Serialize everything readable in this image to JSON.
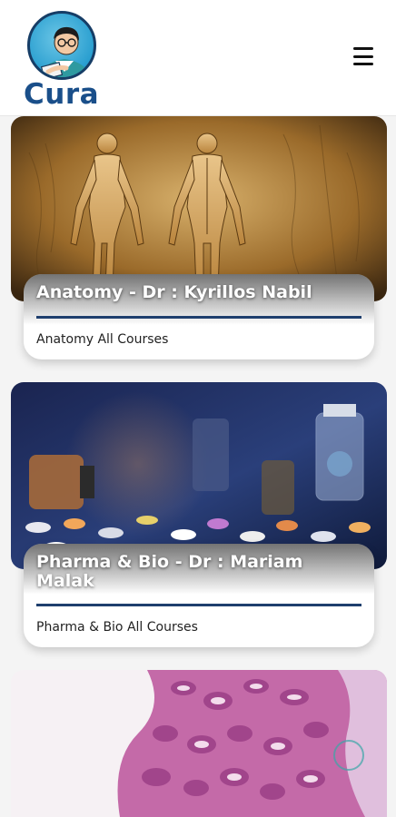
{
  "brand": {
    "name": "Cura",
    "logo_icon": "doctor-reading-book-icon"
  },
  "header": {
    "menu_icon": "hamburger-menu-icon"
  },
  "courses": [
    {
      "title": "Anatomy - Dr : Kyrillos Nabil",
      "subtitle": "Anatomy All Courses",
      "image": "anatomy-figures-image"
    },
    {
      "title": "Pharma & Bio - Dr : Mariam Malak",
      "subtitle": "Pharma & Bio All Courses",
      "image": "pills-and-bottles-image"
    },
    {
      "title": "",
      "subtitle": "",
      "image": "histology-slide-image"
    }
  ],
  "colors": {
    "brand_blue": "#1a4f8a",
    "rule_blue": "#1f3f6e",
    "background": "#f4f4f4"
  }
}
